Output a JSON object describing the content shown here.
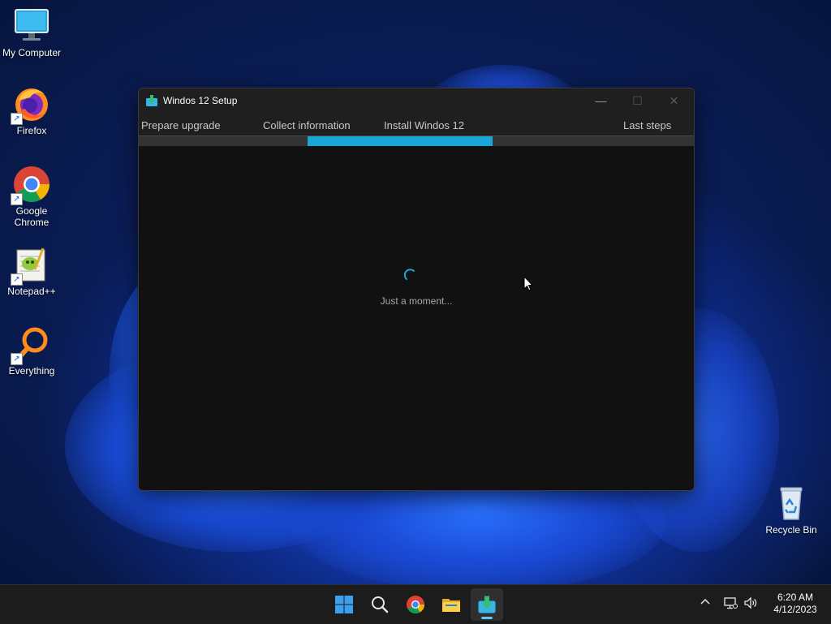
{
  "desktop": {
    "icons": [
      {
        "label": "My Computer",
        "icon": "monitor-icon"
      },
      {
        "label": "Firefox",
        "icon": "firefox-icon"
      },
      {
        "label": "Google Chrome",
        "icon": "chrome-icon"
      },
      {
        "label": "Notepad++",
        "icon": "notepad-plus-plus-icon"
      },
      {
        "label": "Everything",
        "icon": "everything-search-icon"
      },
      {
        "label": "Recycle Bin",
        "icon": "recycle-bin-icon"
      }
    ],
    "shortcut_glyph": "↗"
  },
  "window": {
    "title": "Windos 12 Setup",
    "controls": {
      "minimize": "—",
      "maximize": "☐",
      "close": "✕"
    },
    "steps": [
      "Prepare upgrade",
      "Collect information",
      "Install Windos 12",
      "Last steps"
    ],
    "active_step": 2,
    "progress_fraction": 0.333,
    "status_text": "Just a moment...",
    "accent_color": "#1ba6d8"
  },
  "taskbar": {
    "apps": [
      "start-icon",
      "search-icon",
      "chrome-icon",
      "file-explorer-icon",
      "setup-installer-icon"
    ],
    "active_app": "setup-installer-icon",
    "tray": [
      "chevron-up-icon",
      "network-icon",
      "volume-icon"
    ],
    "clock": {
      "time": "6:20 AM",
      "date": "4/12/2023"
    }
  }
}
